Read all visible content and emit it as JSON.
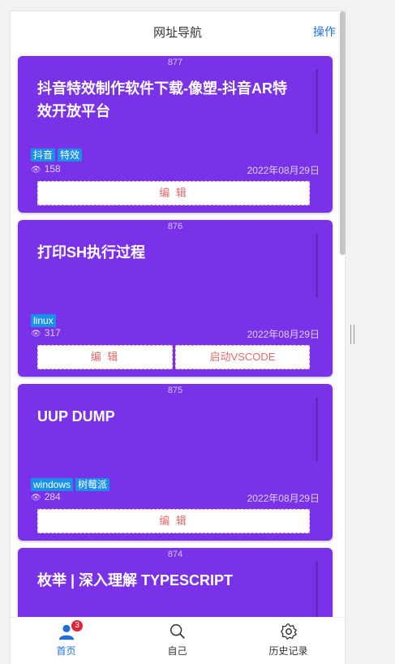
{
  "header": {
    "title": "网址导航",
    "action": "操作"
  },
  "cards": [
    {
      "id": "877",
      "title": "抖音特效制作软件下载-像塑-抖音AR特效开放平台",
      "tags": [
        "抖音",
        "特效"
      ],
      "views": "158",
      "date": "2022年08月29日",
      "buttons": [
        "编 辑"
      ]
    },
    {
      "id": "876",
      "title": "打印SH执行过程",
      "tags": [
        "linux"
      ],
      "views": "317",
      "date": "2022年08月29日",
      "buttons": [
        "编 辑",
        "启动VSCODE"
      ]
    },
    {
      "id": "875",
      "title": "UUP DUMP",
      "tags": [
        "windows",
        "树莓派"
      ],
      "views": "284",
      "date": "2022年08月29日",
      "buttons": [
        "编 辑"
      ]
    },
    {
      "id": "874",
      "title": "枚举 | 深入理解 TYPESCRIPT",
      "tags": [],
      "views": "",
      "date": "",
      "buttons": []
    }
  ],
  "tabbar": {
    "items": [
      {
        "label": "首页",
        "icon": "user-icon",
        "badge": "3",
        "active": true
      },
      {
        "label": "自己",
        "icon": "search-icon"
      },
      {
        "label": "历史记录",
        "icon": "gear-icon"
      }
    ]
  },
  "colors": {
    "card_bg": "#7a32e8",
    "tag_bg": "#1890e8",
    "accent": "#1e6fd9",
    "button_text": "#e06a6a",
    "badge": "#e0263a"
  }
}
